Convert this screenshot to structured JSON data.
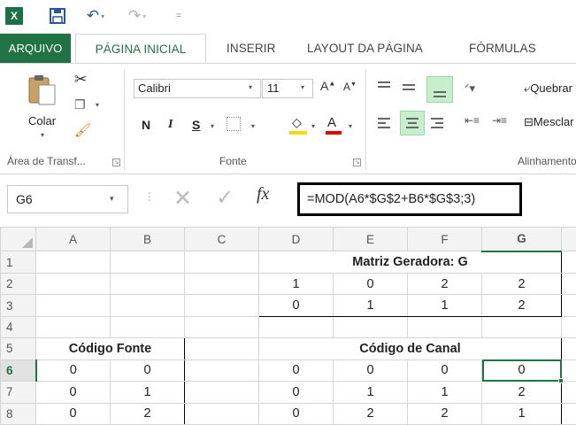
{
  "app": {
    "logo_letter": "X",
    "save_icon": "save-icon",
    "undo_icon": "undo-icon",
    "redo_icon": "redo-icon",
    "qat_more": "="
  },
  "tabs": {
    "file": "ARQUIVO",
    "home": "PÁGINA INICIAL",
    "insert": "INSERIR",
    "layout": "LAYOUT DA PÁGINA",
    "formulas": "FÓRMULAS"
  },
  "ribbon": {
    "clipboard": {
      "paste_label": "Colar",
      "group_label": "Área de Transf..."
    },
    "font": {
      "name": "Calibri",
      "size": "11",
      "bold": "N",
      "italic": "I",
      "underline": "S",
      "grow": "A",
      "shrink": "A",
      "color_glyph": "A",
      "group_label": "Fonte"
    },
    "alignment": {
      "wrap_text": "Quebrar",
      "merge": "Mesclar",
      "group_label": "Alinhamento"
    }
  },
  "formula_bar": {
    "name_box": "G6",
    "formula": "=MOD(A6*$G$2+B6*$G$3;3)",
    "fx": "fx"
  },
  "grid": {
    "columns": [
      "A",
      "B",
      "C",
      "D",
      "E",
      "F",
      "G"
    ],
    "selected_column": "G",
    "selected_row": "6",
    "active_cell": "G6",
    "rows": [
      {
        "n": "1",
        "A": "",
        "B": "",
        "C": "",
        "D": "",
        "E": "Matriz Geradora: G",
        "F": "",
        "G": ""
      },
      {
        "n": "2",
        "A": "",
        "B": "",
        "C": "",
        "D": "1",
        "E": "0",
        "F": "2",
        "G": "2"
      },
      {
        "n": "3",
        "A": "",
        "B": "",
        "C": "",
        "D": "0",
        "E": "1",
        "F": "1",
        "G": "2"
      },
      {
        "n": "4",
        "A": "",
        "B": "",
        "C": "",
        "D": "",
        "E": "",
        "F": "",
        "G": ""
      },
      {
        "n": "5",
        "A": "Código Fonte",
        "B": "",
        "C": "",
        "D": "",
        "E": "Código de Canal",
        "F": "",
        "G": ""
      },
      {
        "n": "6",
        "A": "0",
        "B": "0",
        "C": "",
        "D": "0",
        "E": "0",
        "F": "0",
        "G": "0"
      },
      {
        "n": "7",
        "A": "0",
        "B": "1",
        "C": "",
        "D": "0",
        "E": "1",
        "F": "1",
        "G": "2"
      },
      {
        "n": "8",
        "A": "0",
        "B": "2",
        "C": "",
        "D": "0",
        "E": "2",
        "F": "2",
        "G": "1"
      }
    ]
  },
  "colors": {
    "accent": "#217346",
    "selection_fill": "#c6efce",
    "fill_color": "#ffd700",
    "font_color": "#e00000"
  }
}
